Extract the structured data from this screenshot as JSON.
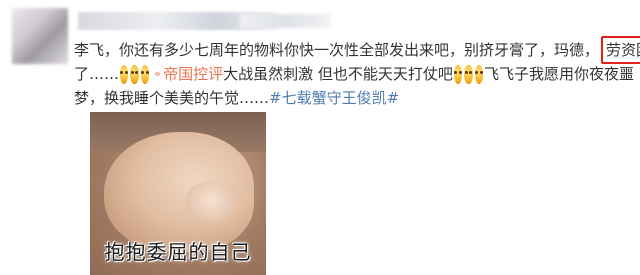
{
  "post": {
    "line1_part1": "李飞，你还有多少七周年的物料你快一次性全部发出来吧，别挤牙膏了，玛德，",
    "line1_highlight": "劳资困死",
    "line2_part1": "了……",
    "line2_link": "帝国控评",
    "line2_part2": "大战虽然刺激 但也不能天天打仗吧",
    "line2_part3": " 飞飞子我愿用你夜夜噩",
    "line3_part1": "梦，换我睡个美美的午觉……",
    "line3_topic": "#七载蟹守王俊凯#"
  },
  "image": {
    "caption": "抱抱委屈的自己"
  },
  "colors": {
    "link": "#eb7350",
    "topic": "#507daf",
    "highlight_border": "#e0221a",
    "text": "#333333"
  },
  "icons": [
    "scream-emoji-icon",
    "link-icon",
    "smile-emoji-icon"
  ]
}
